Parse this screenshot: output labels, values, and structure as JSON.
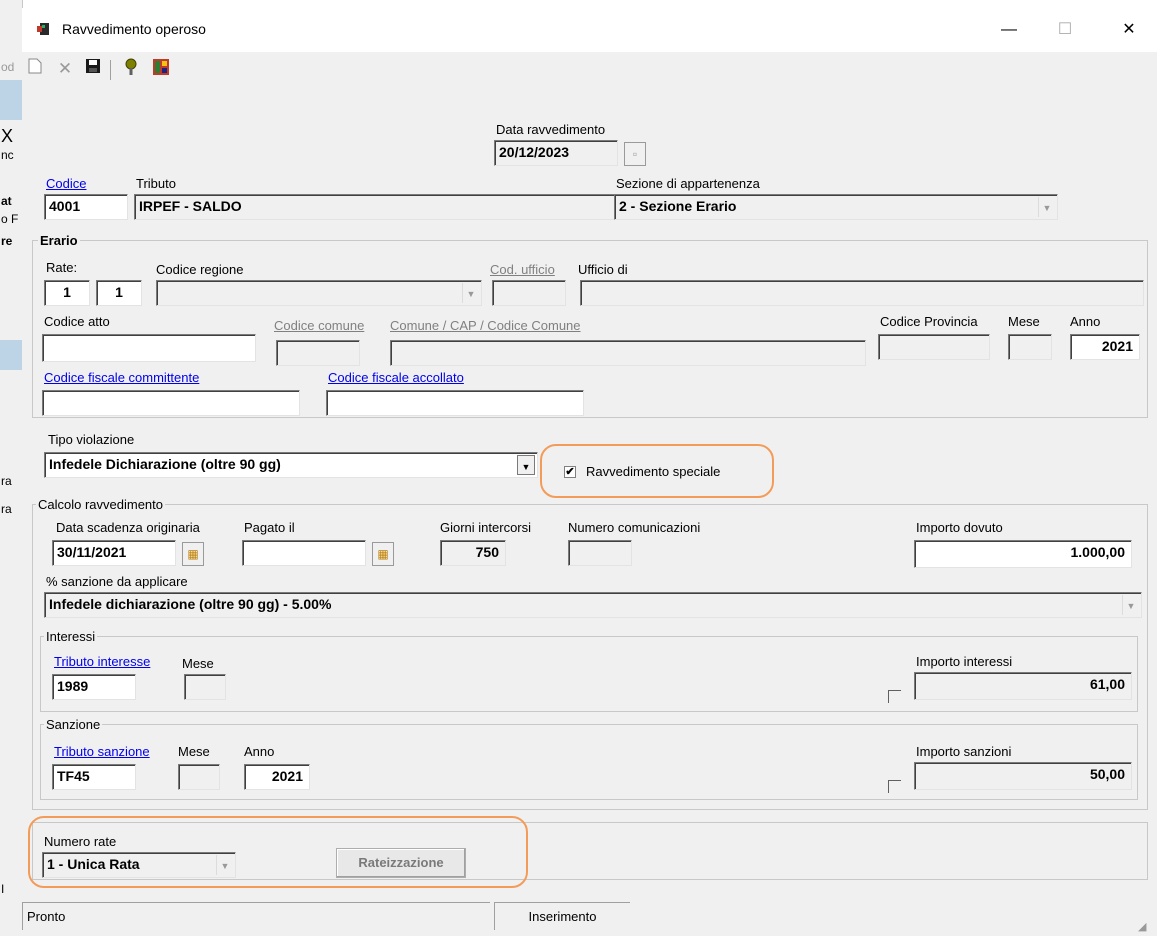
{
  "window": {
    "title": "Ravvedimento operoso",
    "minimize": "—",
    "maximize": "☐",
    "close": "✕"
  },
  "background": {
    "fragments": [
      "od",
      "X",
      "nc",
      "at",
      "o F",
      "re",
      "ra",
      "ra",
      "I"
    ]
  },
  "toolbar": {
    "new_icon": "new-document-icon",
    "delete_icon": "delete-icon",
    "save_icon": "save-icon",
    "help_icon": "help-icon",
    "calc_icon": "calculator-icon"
  },
  "header": {
    "data_label": "Data ravvedimento",
    "data_value": "20/12/2023",
    "codice_label": "Codice",
    "codice_value": "4001",
    "tributo_label": "Tributo",
    "tributo_value": "IRPEF - SALDO",
    "sezione_label": "Sezione di appartenenza",
    "sezione_value": "2 - Sezione Erario"
  },
  "erario": {
    "group_label": "Erario",
    "rate_label": "Rate:",
    "rate_1": "1",
    "rate_2": "1",
    "codice_regione_label": "Codice regione",
    "codice_regione_value": "",
    "cod_ufficio_label": "Cod. ufficio",
    "ufficio_di_label": "Ufficio di",
    "codice_atto_label": "Codice atto",
    "codice_comune_label": "Codice comune",
    "comune_cap_label": "Comune / CAP / Codice Comune",
    "codice_provincia_label": "Codice Provincia",
    "mese_label": "Mese",
    "anno_label": "Anno",
    "anno_value": "2021",
    "cf_committente_label": "Codice fiscale committente",
    "cf_accollato_label": "Codice fiscale accollato"
  },
  "violazione": {
    "label": "Tipo violazione",
    "value": "Infedele Dichiarazione (oltre 90 gg)",
    "speciale_label": "Ravvedimento speciale",
    "speciale_checked": true
  },
  "calcolo": {
    "group_label": "Calcolo ravvedimento",
    "scadenza_label": "Data scadenza originaria",
    "scadenza_value": "30/11/2021",
    "pagato_label": "Pagato il",
    "pagato_value": "",
    "giorni_label": "Giorni intercorsi",
    "giorni_value": "750",
    "numcom_label": "Numero comunicazioni",
    "importo_dovuto_label": "Importo dovuto",
    "importo_dovuto_value": "1.000,00",
    "sanzione_pct_label": "% sanzione da applicare",
    "sanzione_pct_value": "Infedele dichiarazione (oltre 90 gg) - 5.00%"
  },
  "interessi": {
    "group_label": "Interessi",
    "tributo_label": "Tributo interesse",
    "tributo_value": "1989",
    "mese_label": "Mese",
    "importo_label": "Importo interessi",
    "importo_value": "61,00"
  },
  "sanzione": {
    "group_label": "Sanzione",
    "tributo_label": "Tributo sanzione",
    "tributo_value": "TF45",
    "mese_label": "Mese",
    "anno_label": "Anno",
    "anno_value": "2021",
    "importo_label": "Importo sanzioni",
    "importo_value": "50,00"
  },
  "rate": {
    "label": "Numero rate",
    "value": "1 - Unica Rata",
    "button": "Rateizzazione"
  },
  "status": {
    "left": "Pronto",
    "mode": "Inserimento"
  },
  "colors": {
    "highlight": "#f39c5a",
    "link": "#0000ee",
    "window_bg": "#f0f0f0"
  }
}
